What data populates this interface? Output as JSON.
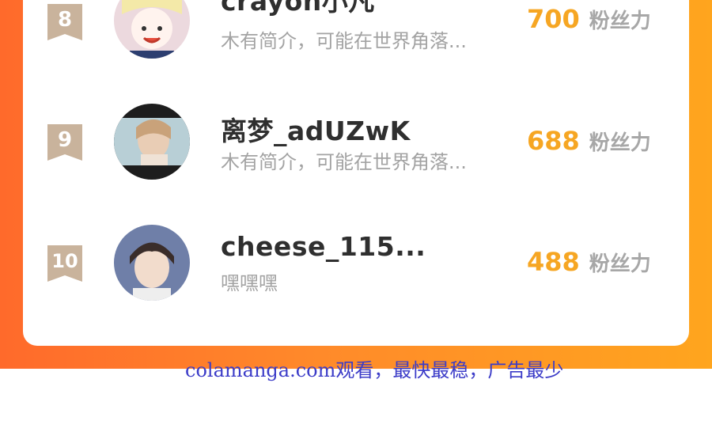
{
  "rankings": [
    {
      "rank": "8",
      "name": "crayon小凡",
      "bio": "木有简介，可能在世界角落...",
      "fans": "700",
      "fans_unit": "粉丝力"
    },
    {
      "rank": "9",
      "name": "离梦_adUZwK",
      "bio": "木有简介，可能在世界角落...",
      "fans": "688",
      "fans_unit": "粉丝力"
    },
    {
      "rank": "10",
      "name": "cheese_115...",
      "bio": "嘿嘿嘿",
      "fans": "488",
      "fans_unit": "粉丝力"
    }
  ],
  "footer": {
    "text": "colamanga.com观看，最快最稳，广告最少"
  },
  "colors": {
    "accent": "#f6a623",
    "badge": "#c9b39c",
    "band_start": "#ff6a2b",
    "band_end": "#ffa51e",
    "footer_text": "#3c3cc8"
  }
}
